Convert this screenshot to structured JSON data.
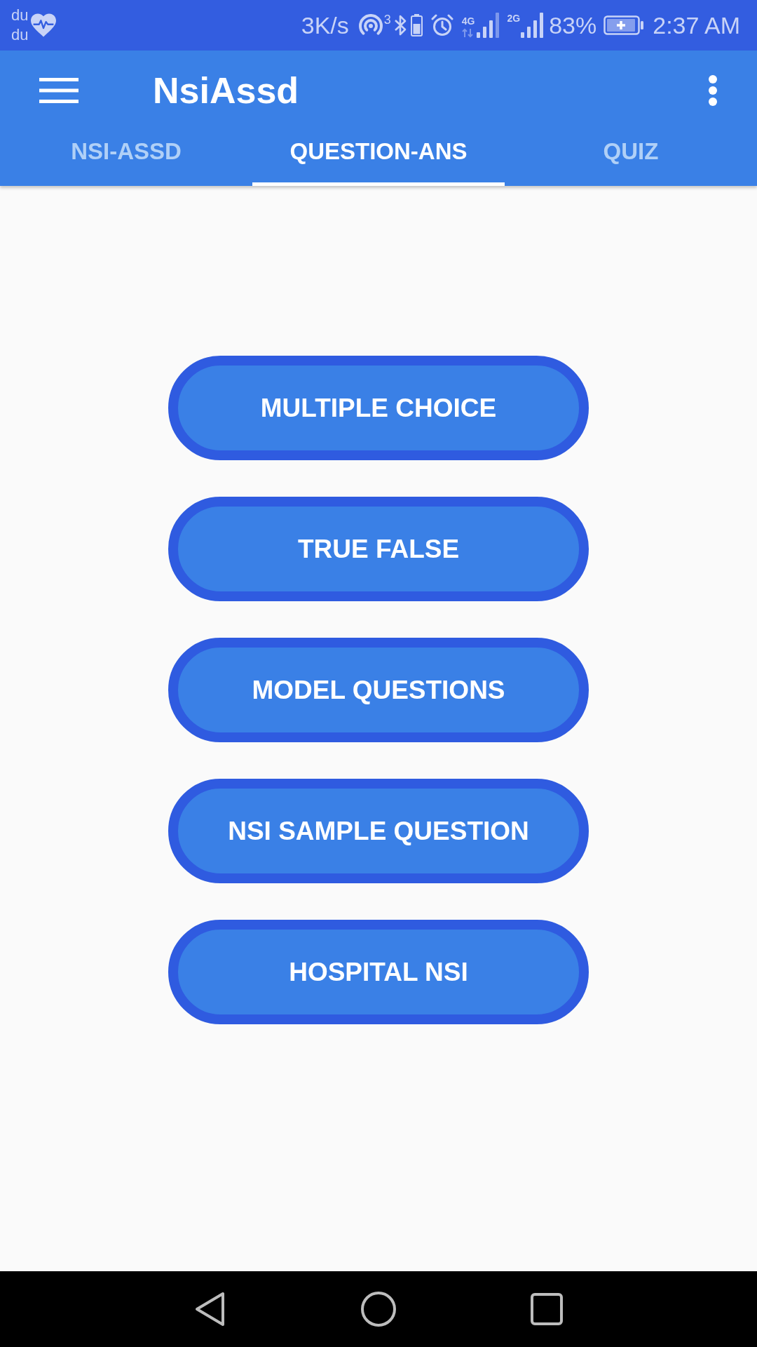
{
  "status_bar": {
    "carrier_lines": [
      "du",
      "du"
    ],
    "network_speed": "3K/s",
    "hotspot_count": "3",
    "sim_1_network": "4G",
    "sim_2_network": "2G",
    "battery": "83%",
    "time": "2:37 AM"
  },
  "app_bar": {
    "title": "NsiAssd"
  },
  "tabs": [
    {
      "label": "NSI-ASSD",
      "selected": false
    },
    {
      "label": "QUESTION-ANS",
      "selected": true
    },
    {
      "label": "QUIZ",
      "selected": false
    }
  ],
  "buttons": [
    {
      "label": "MULTIPLE CHOICE"
    },
    {
      "label": "TRUE FALSE"
    },
    {
      "label": "MODEL QUESTIONS"
    },
    {
      "label": "NSI SAMPLE QUESTION"
    },
    {
      "label": "HOSPITAL NSI"
    }
  ]
}
